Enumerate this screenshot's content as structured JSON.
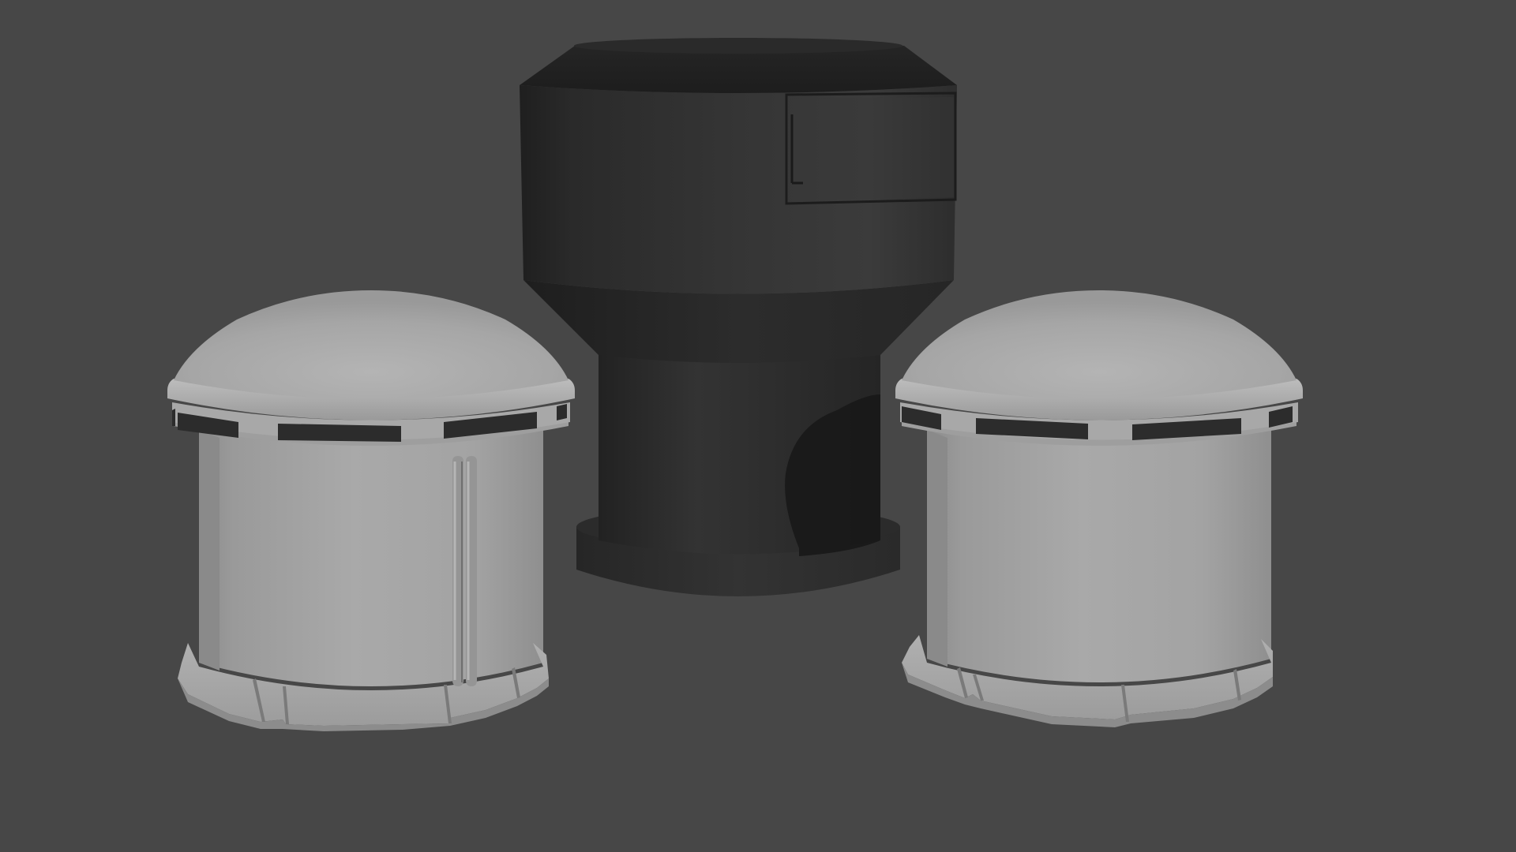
{
  "scene": {
    "background_color": "#474747",
    "objects": [
      {
        "name": "left-dome-hut",
        "type": "dome-hut",
        "color": "#a6a6a6",
        "door": "double-pipe"
      },
      {
        "name": "center-tower",
        "type": "tower",
        "color": "#2e2e2e",
        "hatch": "rectangular-panel"
      },
      {
        "name": "right-dome-hut",
        "type": "dome-hut",
        "color": "#a6a6a6",
        "door": "none"
      }
    ]
  }
}
